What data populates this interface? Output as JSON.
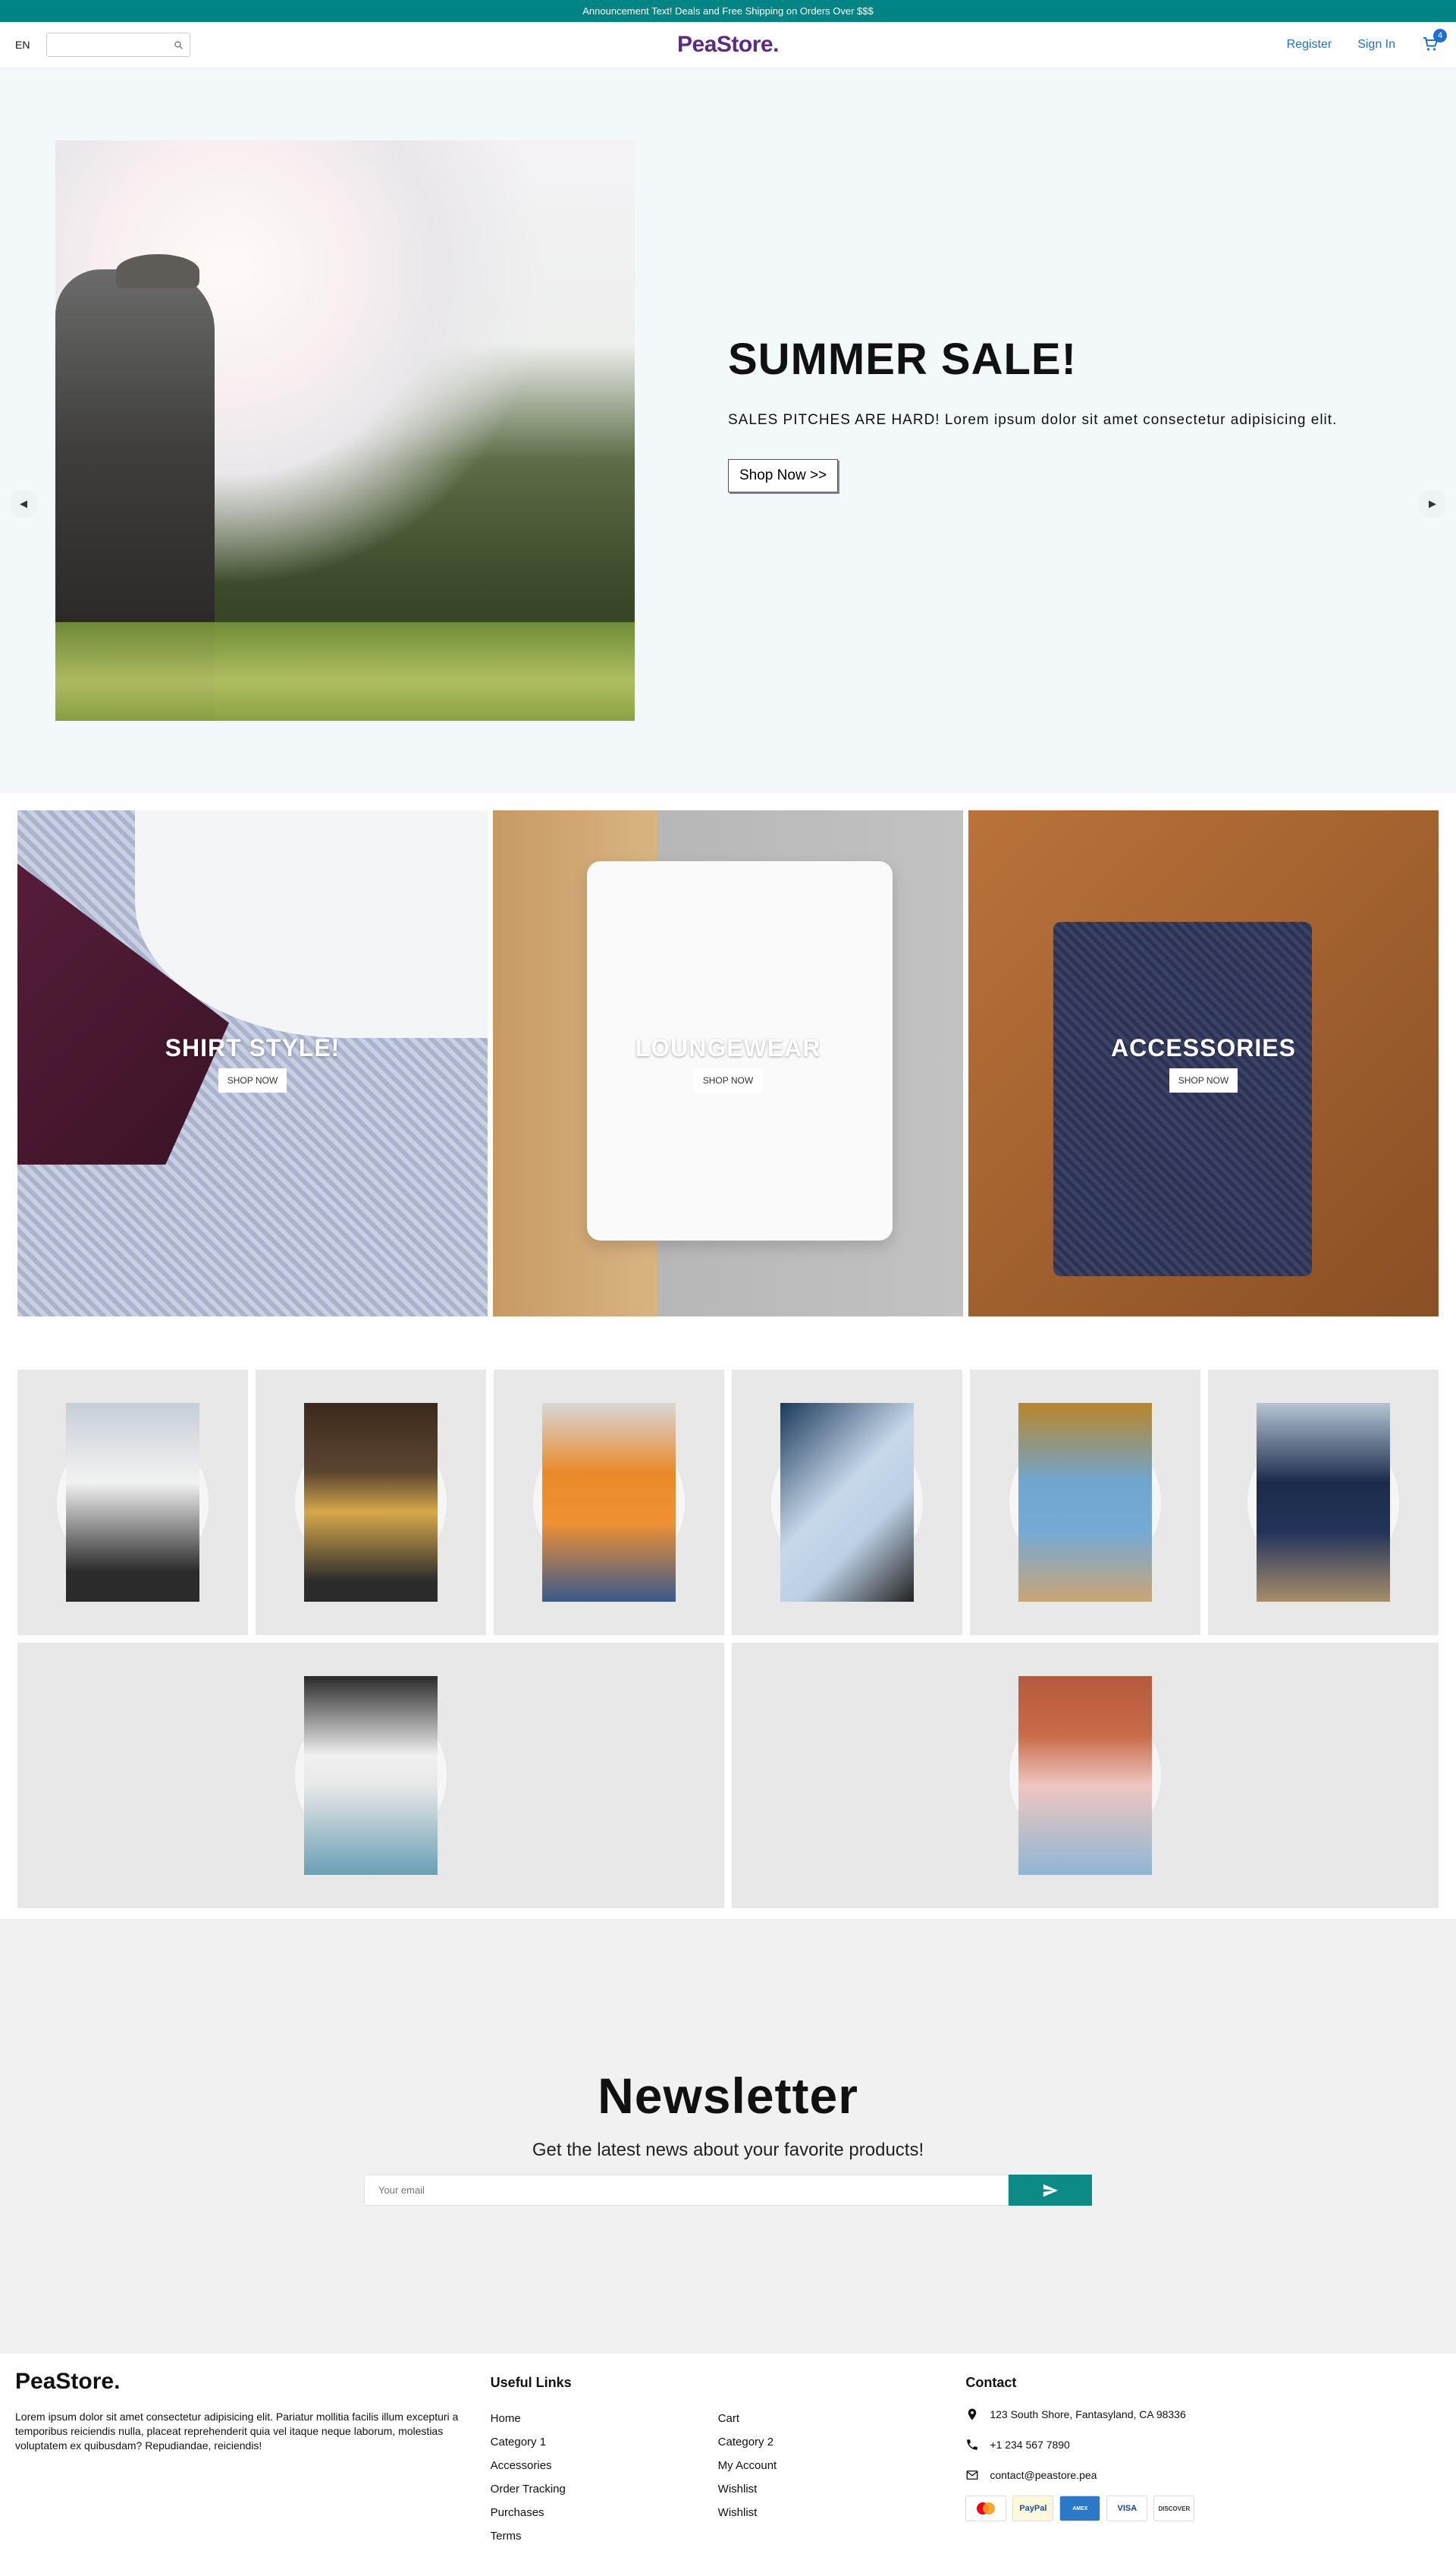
{
  "announcement": "Announcement Text! Deals and Free Shipping on Orders Over $$$",
  "nav": {
    "language": "EN",
    "logo": "PeaStore.",
    "register": "Register",
    "sign_in": "Sign In",
    "cart_count": "4"
  },
  "hero": {
    "title": "SUMMER SALE!",
    "description": "SALES PITCHES ARE HARD! Lorem ipsum dolor sit amet consectetur adipisicing elit.",
    "button": "Shop Now >>"
  },
  "categories": [
    {
      "title": "SHIRT STYLE!",
      "button": "SHOP NOW"
    },
    {
      "title": "LOUNGEWEAR",
      "button": "SHOP NOW"
    },
    {
      "title": "ACCESSORIES",
      "button": "SHOP NOW"
    }
  ],
  "newsletter": {
    "title": "Newsletter",
    "subtitle": "Get the latest news about your favorite products!",
    "placeholder": "Your email"
  },
  "footer": {
    "logo": "PeaStore.",
    "description": "Lorem ipsum dolor sit amet consectetur adipisicing elit. Pariatur mollitia facilis illum excepturi a temporibus reiciendis nulla, placeat reprehenderit quia vel itaque neque laborum, molestias voluptatem ex quibusdam? Repudiandae, reiciendis!",
    "links_heading": "Useful Links",
    "links_col1": [
      "Home",
      "Category 1",
      "Accessories",
      "Order Tracking",
      "Purchases",
      "Terms"
    ],
    "links_col2": [
      "Cart",
      "Category 2",
      "My Account",
      "Wishlist",
      "Wishlist"
    ],
    "contact_heading": "Contact",
    "address": "123 South Shore, Fantasyland, CA 98336",
    "phone": "+1 234 567 7890",
    "email": "contact@peastore.pea",
    "payments": [
      "MasterCard",
      "PayPal",
      "AmericanExpress",
      "VISA",
      "DISCOVER"
    ]
  },
  "colors": {
    "accent": "#008584",
    "brand": "#5b2a86",
    "link": "#1f6fd6"
  }
}
